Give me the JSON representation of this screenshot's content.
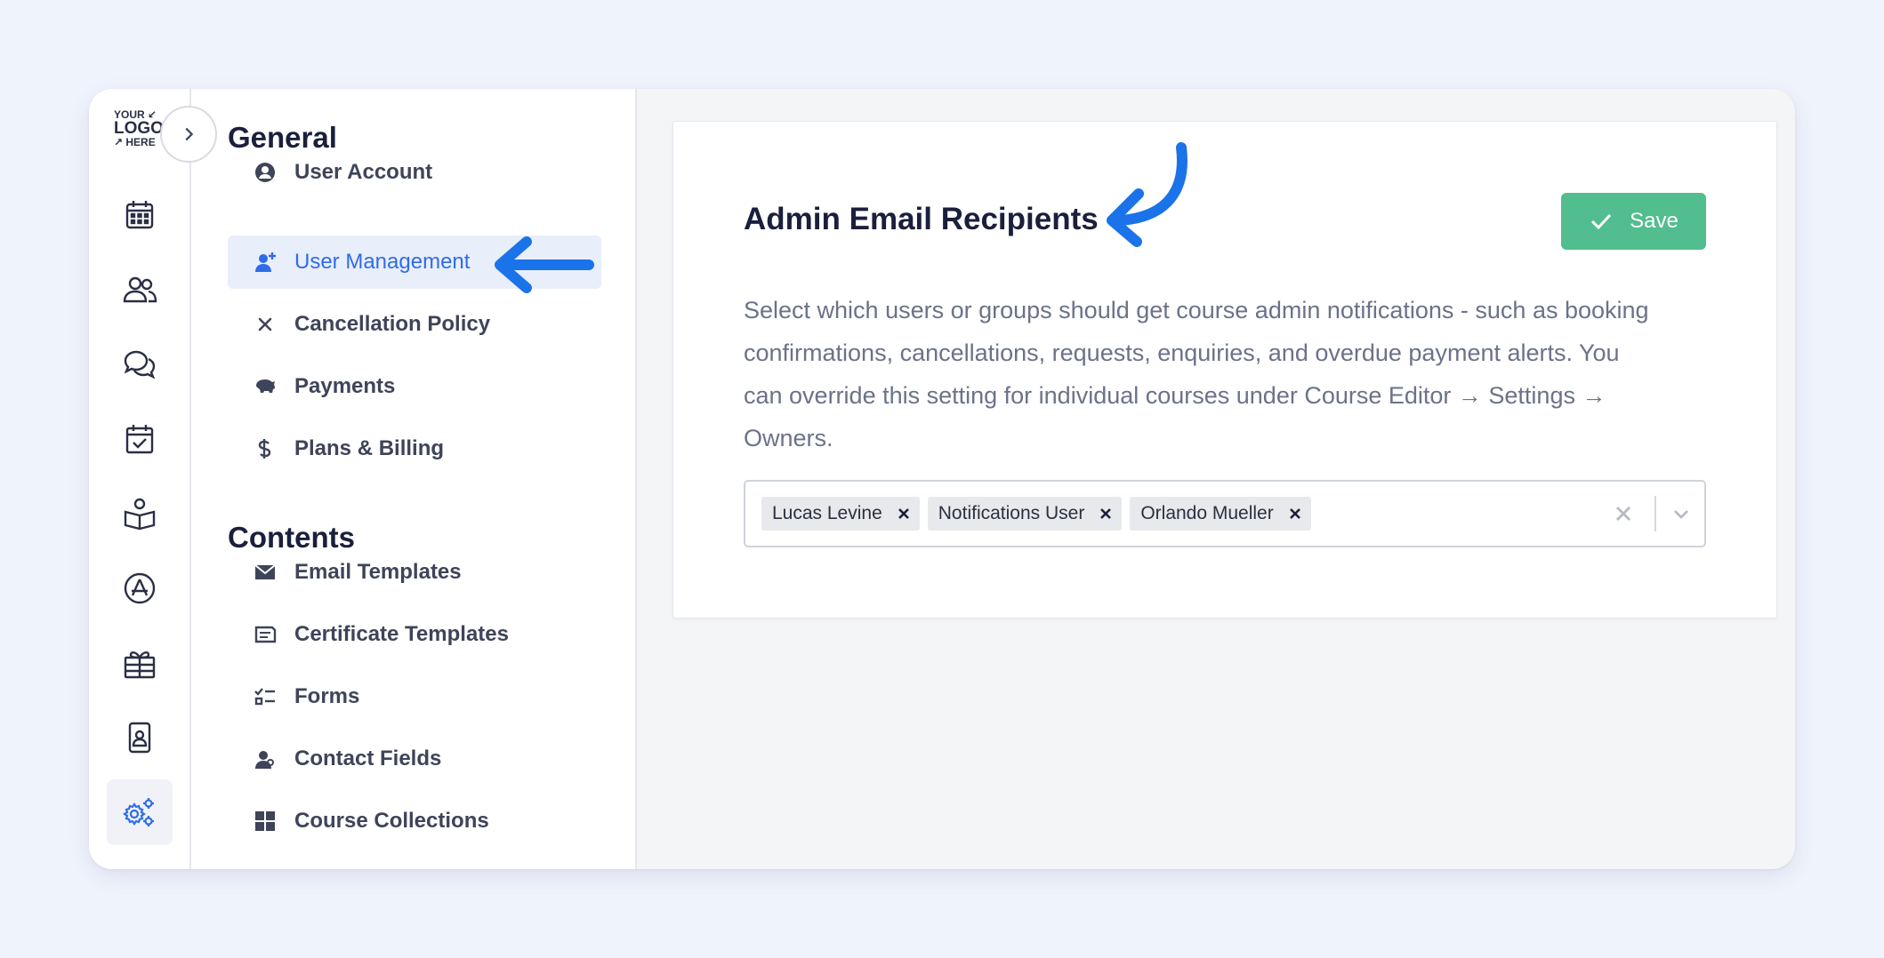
{
  "rail": {
    "logo": {
      "line1": "YOUR ↙",
      "line2": "LOGO",
      "line3": "↗ HERE"
    },
    "icons": [
      "calendar-icon",
      "users-icon",
      "chat-icon",
      "calendar-check-icon",
      "book-reader-icon",
      "app-store-icon",
      "gift-icon",
      "contact-card-icon",
      "settings-gears-icon"
    ],
    "active_icon": "settings-gears-icon",
    "accent": "#2f6ce8"
  },
  "nav": {
    "general_title": "General",
    "general_items": [
      {
        "label": "User Account",
        "icon": "user-circle-icon"
      },
      {
        "label": "User Management",
        "icon": "user-plus-icon",
        "active": true
      },
      {
        "label": "Cancellation Policy",
        "icon": "x-icon"
      },
      {
        "label": "Payments",
        "icon": "piggy-bank-icon"
      },
      {
        "label": "Plans & Billing",
        "icon": "dollar-icon"
      }
    ],
    "contents_title": "Contents",
    "contents_items": [
      {
        "label": "Email Templates",
        "icon": "envelope-icon"
      },
      {
        "label": "Certificate Templates",
        "icon": "certificate-icon"
      },
      {
        "label": "Forms",
        "icon": "checklist-icon"
      },
      {
        "label": "Contact Fields",
        "icon": "contact-icon"
      },
      {
        "label": "Course Collections",
        "icon": "grid-icon"
      }
    ]
  },
  "main": {
    "title": "Admin Email Recipients",
    "save_label": "Save",
    "description": "Select which users or groups should get course admin notifications - such as booking confirmations, cancellations, requests, enquiries, and overdue payment alerts. You can override this setting for individual courses under Course Editor → Settings → Owners.",
    "recipients": [
      "Lucas Levine",
      "Notifications User",
      "Orlando Mueller"
    ]
  },
  "colors": {
    "save_button": "#52bd8e",
    "annotation_arrow": "#1a73e8",
    "active_nav_bg": "#e9eefb"
  }
}
